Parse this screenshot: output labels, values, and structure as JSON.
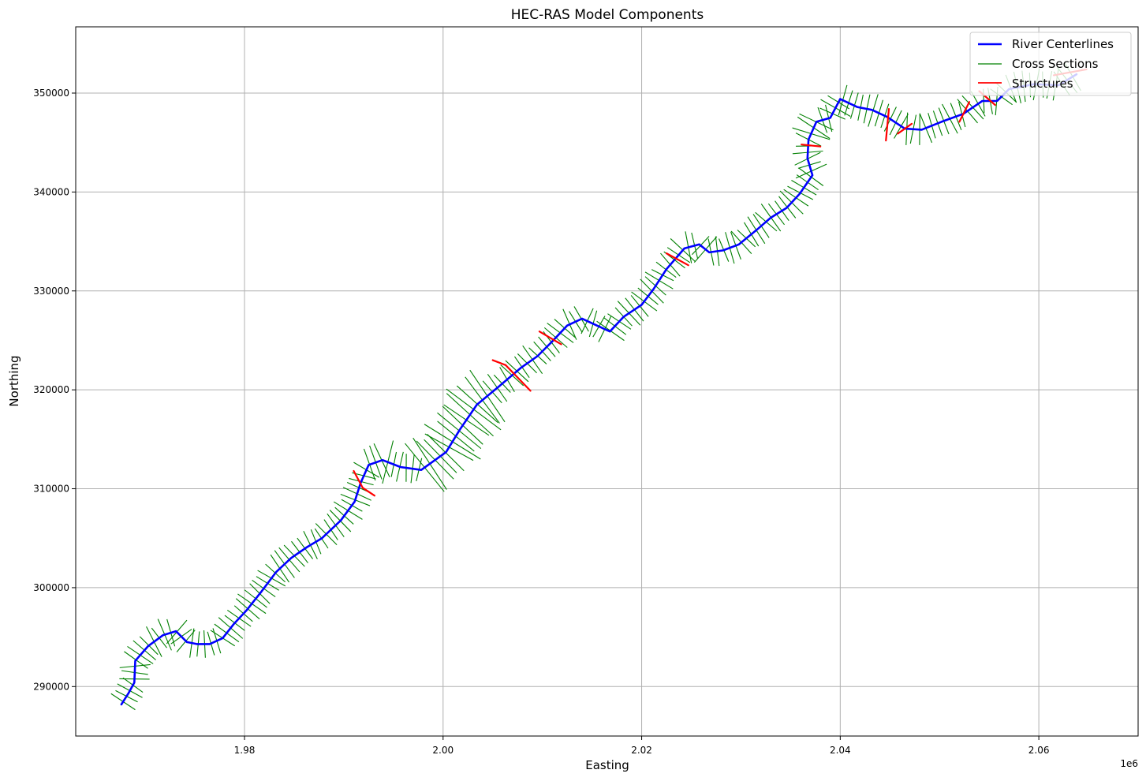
{
  "chart_data": {
    "type": "line",
    "title": "HEC-RAS Model Components",
    "xlabel": "Easting",
    "ylabel": "Northing",
    "x_offset_label": "1e6",
    "xlim": [
      1963000,
      2070000
    ],
    "ylim": [
      285000,
      356700
    ],
    "xticks": [
      1980000,
      2000000,
      2020000,
      2040000,
      2060000
    ],
    "xtick_labels": [
      "1.98",
      "2.00",
      "2.02",
      "2.04",
      "2.06"
    ],
    "yticks": [
      290000,
      300000,
      310000,
      320000,
      330000,
      340000,
      350000
    ],
    "ytick_labels": [
      "290000",
      "300000",
      "310000",
      "320000",
      "330000",
      "340000",
      "350000"
    ],
    "grid": true,
    "legend_position": "upper-right",
    "colors": {
      "river": "#0000ff",
      "cross": "#008000",
      "structure": "#ff0000"
    },
    "series": [
      {
        "name": "River Centerlines",
        "kind": "line",
        "points": [
          [
            1967600,
            288200
          ],
          [
            1968300,
            289300
          ],
          [
            1968900,
            290400
          ],
          [
            1969000,
            292600
          ],
          [
            1970300,
            294100
          ],
          [
            1971800,
            295200
          ],
          [
            1973100,
            295600
          ],
          [
            1974200,
            294500
          ],
          [
            1975200,
            294300
          ],
          [
            1976500,
            294300
          ],
          [
            1977800,
            294900
          ],
          [
            1978900,
            296300
          ],
          [
            1980200,
            297700
          ],
          [
            1981700,
            299600
          ],
          [
            1983200,
            301600
          ],
          [
            1984700,
            303000
          ],
          [
            1986300,
            304100
          ],
          [
            1987800,
            305000
          ],
          [
            1989700,
            306800
          ],
          [
            1991100,
            308700
          ],
          [
            1991700,
            310600
          ],
          [
            1992500,
            312400
          ],
          [
            1993900,
            312900
          ],
          [
            1995700,
            312200
          ],
          [
            1997800,
            311900
          ],
          [
            2000300,
            313700
          ],
          [
            2001700,
            316000
          ],
          [
            2003400,
            318500
          ],
          [
            2005700,
            320400
          ],
          [
            2007800,
            322200
          ],
          [
            2009500,
            323400
          ],
          [
            2011000,
            324900
          ],
          [
            2012500,
            326500
          ],
          [
            2014000,
            327200
          ],
          [
            2015500,
            326500
          ],
          [
            2016800,
            325900
          ],
          [
            2018200,
            327400
          ],
          [
            2020000,
            328600
          ],
          [
            2021200,
            330200
          ],
          [
            2022500,
            332200
          ],
          [
            2024300,
            334300
          ],
          [
            2025800,
            334700
          ],
          [
            2026800,
            333900
          ],
          [
            2028200,
            334100
          ],
          [
            2029800,
            334700
          ],
          [
            2031500,
            336100
          ],
          [
            2033000,
            337400
          ],
          [
            2034600,
            338400
          ],
          [
            2035900,
            339800
          ],
          [
            2037200,
            341700
          ],
          [
            2036700,
            343400
          ],
          [
            2036800,
            345300
          ],
          [
            2037600,
            347100
          ],
          [
            2039000,
            347500
          ],
          [
            2040000,
            349400
          ],
          [
            2041700,
            348600
          ],
          [
            2043200,
            348300
          ],
          [
            2044700,
            347600
          ],
          [
            2046500,
            346400
          ],
          [
            2048200,
            346300
          ],
          [
            2050200,
            347100
          ],
          [
            2052400,
            347900
          ],
          [
            2054300,
            349200
          ],
          [
            2055800,
            349200
          ],
          [
            2057000,
            350400
          ],
          [
            2059500,
            350900
          ],
          [
            2062000,
            350800
          ],
          [
            2063800,
            351900
          ]
        ]
      },
      {
        "name": "Cross Sections",
        "kind": "segments",
        "segment_length": 2800,
        "station_spacing": 650,
        "wide_ranges": [
          [
            1992500,
            1994500,
            4200
          ],
          [
            1998000,
            2004500,
            6000
          ],
          [
            2037000,
            2039000,
            3600
          ]
        ]
      },
      {
        "name": "Structures",
        "kind": "segments",
        "segments": [
          [
            [
              1991000,
              311800
            ],
            [
              1991900,
              310100
            ]
          ],
          [
            [
              1991900,
              310100
            ],
            [
              1993100,
              309300
            ]
          ],
          [
            [
              2005000,
              323000
            ],
            [
              2006300,
              322500
            ]
          ],
          [
            [
              2006300,
              322500
            ],
            [
              2008800,
              319900
            ]
          ],
          [
            [
              2009700,
              325900
            ],
            [
              2011900,
              324600
            ]
          ],
          [
            [
              2022500,
              333800
            ],
            [
              2024700,
              332600
            ]
          ],
          [
            [
              2036100,
              344800
            ],
            [
              2038000,
              344600
            ]
          ],
          [
            [
              2044600,
              345200
            ],
            [
              2044900,
              348400
            ]
          ],
          [
            [
              2045800,
              345900
            ],
            [
              2047200,
              346900
            ]
          ],
          [
            [
              2052000,
              347100
            ],
            [
              2053000,
              349100
            ]
          ],
          [
            [
              2054000,
              350200
            ],
            [
              2055600,
              348800
            ]
          ],
          [
            [
              2061500,
              351800
            ],
            [
              2064800,
              352400
            ]
          ]
        ]
      }
    ]
  }
}
